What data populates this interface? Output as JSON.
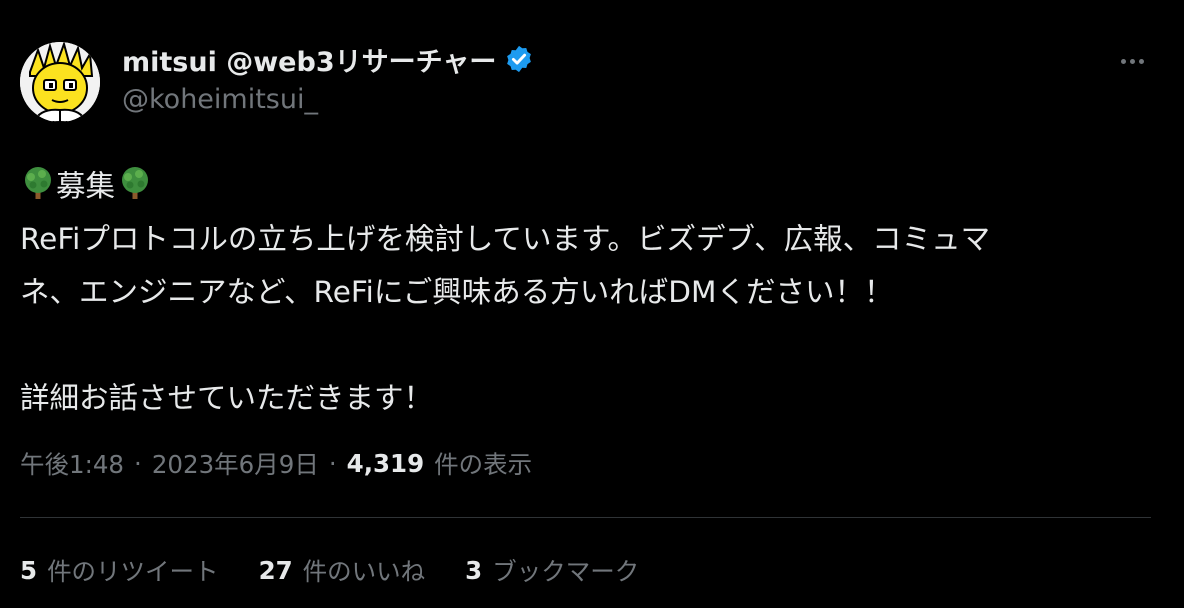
{
  "user": {
    "display_name": "mitsui @web3リサーチャー",
    "handle": "@koheimitsui_",
    "verified": true,
    "verified_color": "#1d9bf0"
  },
  "tweet": {
    "heading_emoji": "deciduous-tree",
    "heading": "募集",
    "lines": [
      "ReFiプロトコルの立ち上げを検討しています。ビズデブ、広報、コミュマ",
      "ネ、エンジニアなど、ReFiにご興味ある方いればDMください！！",
      "詳細お話させていただきます！"
    ]
  },
  "meta": {
    "time": "午後1:48",
    "separator": "·",
    "date": "2023年6月9日",
    "views_count": "4,319",
    "views_label": "件の表示"
  },
  "stats": {
    "retweets_count": "5",
    "retweets_label": "件のリツイート",
    "likes_count": "27",
    "likes_label": "件のいいね",
    "bookmarks_count": "3",
    "bookmarks_label": "ブックマーク"
  },
  "colors": {
    "background": "#000000",
    "text_primary": "#e7e9ea",
    "text_secondary": "#71767b",
    "divider": "#2f3336"
  }
}
